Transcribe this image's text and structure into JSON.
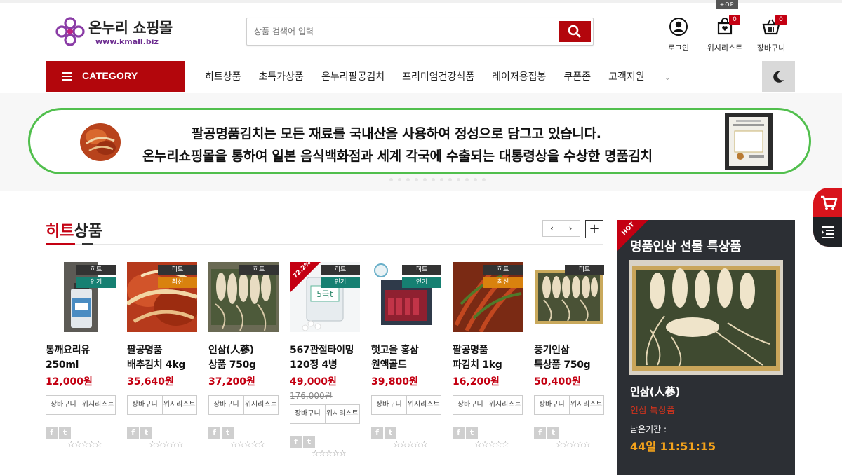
{
  "header": {
    "logo_text": "온누리 쇼핑몰",
    "logo_url": "www.kmall.biz",
    "search_placeholder": "상품 검색어 입력",
    "op_tag": "+OP",
    "login_label": "로그인",
    "wishlist_label": "위시리스트",
    "wishlist_count": "0",
    "cart_label": "장바구니",
    "cart_count": "0"
  },
  "nav": {
    "category_label": "CATEGORY",
    "items": [
      "히트상품",
      "초특가상품",
      "온누리팔공김치",
      "프리미엄건강식품",
      "레이저용접봉",
      "쿠폰존",
      "고객지원"
    ]
  },
  "banner": {
    "line1": "팔공명품김치는 모든 재료를 국내산을 사용하여 정성으로 담그고 있습니다.",
    "line2": "온누리쇼핑몰을 통하여 일본 음식백화점과 세계 각국에 수출되는 대통령상을 수상한 명품김치"
  },
  "section": {
    "title_red": "히트",
    "title_rest": "상품"
  },
  "products": [
    {
      "name_l1": "통깨요리유",
      "name_l2": "250ml",
      "price": "12,000원",
      "tag": "히트",
      "sub_tag": "인기",
      "btn_cart": "장바구니",
      "btn_wish": "위시리스트"
    },
    {
      "name_l1": "팔공명품",
      "name_l2": "배추김치 4kg",
      "price": "35,640원",
      "tag": "히트",
      "sub_tag": "최신",
      "btn_cart": "장바구니",
      "btn_wish": "위시리스트"
    },
    {
      "name_l1": "인삼(人蔘)",
      "name_l2": "상품 750g",
      "price": "37,200원",
      "tag": "히트",
      "sub_tag": "",
      "btn_cart": "장바구니",
      "btn_wish": "위시리스트"
    },
    {
      "name_l1": "567관절타이밍",
      "name_l2": "120정 4병",
      "price": "49,000원",
      "old_price": "176,000원",
      "sale": "72.2%",
      "tag": "히트",
      "sub_tag": "인기",
      "btn_cart": "장바구니",
      "btn_wish": "위시리스트"
    },
    {
      "name_l1": "햇고을 홍삼",
      "name_l2": "원액골드",
      "price": "39,800원",
      "tag": "히트",
      "sub_tag": "인기",
      "btn_cart": "장바구니",
      "btn_wish": "위시리스트"
    },
    {
      "name_l1": "팔공명품",
      "name_l2": "파김치 1kg",
      "price": "16,200원",
      "tag": "히트",
      "sub_tag": "최신",
      "btn_cart": "장바구니",
      "btn_wish": "위시리스트"
    },
    {
      "name_l1": "풍기인삼",
      "name_l2": "특상품 750g",
      "price": "50,400원",
      "tag": "히트",
      "sub_tag": "",
      "btn_cart": "장바구니",
      "btn_wish": "위시리스트"
    }
  ],
  "hot": {
    "badge": "HOT",
    "title": "명품인삼 선물 특상품",
    "name": "인삼(人蔘)",
    "sub": "인삼 특상품",
    "remain_label": "남은기간 :",
    "timer": "44일 11:51:15"
  },
  "colors": {
    "accent_red": "#b3060c",
    "banner_border": "#51bf4d",
    "tag_popular": "#168072",
    "tag_new": "#d9820e",
    "timer": "#f3a21b"
  }
}
